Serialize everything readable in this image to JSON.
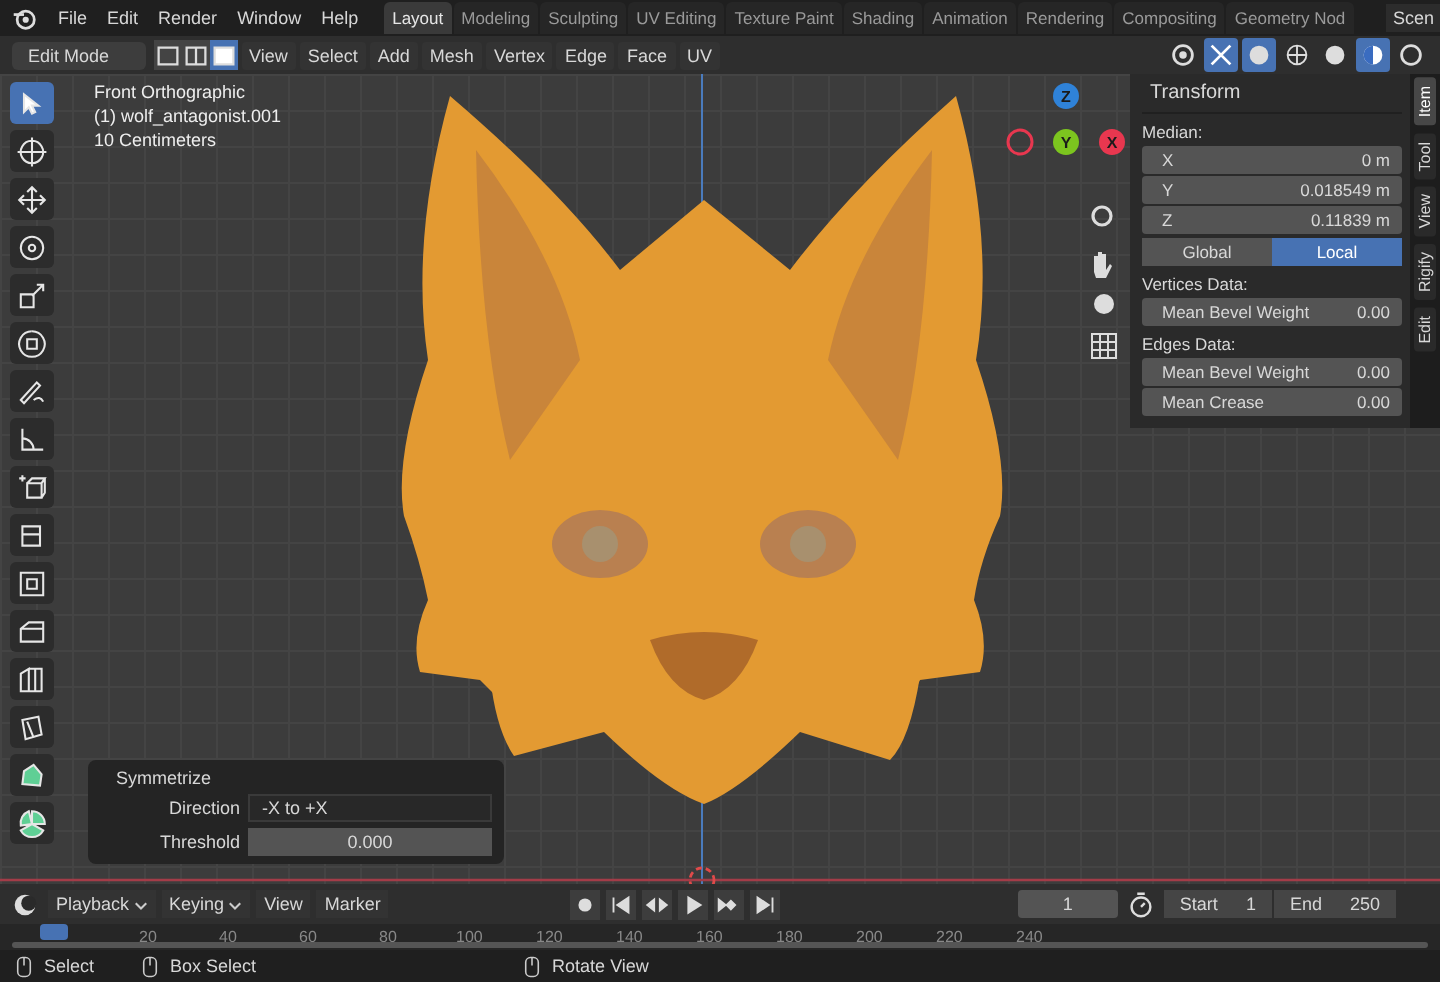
{
  "menu_bar": {
    "menus": [
      "File",
      "Edit",
      "Render",
      "Window",
      "Help"
    ],
    "workspaces": [
      {
        "label": "Layout",
        "selected": true
      },
      {
        "label": "Modeling",
        "selected": false
      },
      {
        "label": "Sculpting",
        "selected": false
      },
      {
        "label": "UV Editing",
        "selected": false
      },
      {
        "label": "Texture Paint",
        "selected": false
      },
      {
        "label": "Shading",
        "selected": false
      },
      {
        "label": "Animation",
        "selected": false
      },
      {
        "label": "Rendering",
        "selected": false
      },
      {
        "label": "Compositing",
        "selected": false
      },
      {
        "label": "Geometry Nod",
        "selected": false
      }
    ],
    "scene": "Scen"
  },
  "header": {
    "mode": "Edit Mode",
    "select_modes": [
      {
        "kind": "vertex",
        "selected": false
      },
      {
        "kind": "edge",
        "selected": false
      },
      {
        "kind": "face",
        "selected": true
      }
    ],
    "menus": [
      "View",
      "Select",
      "Add",
      "Mesh",
      "Vertex",
      "Edge",
      "Face",
      "UV"
    ]
  },
  "viewport": {
    "view_name": "Front Orthographic",
    "object": "(1) wolf_antagonist.001",
    "scale": "10 Centimeters",
    "gizmo_axes": [
      {
        "label": "Z",
        "color": "#2f82d8"
      },
      {
        "label": "Y",
        "color": "#7cc51f"
      },
      {
        "label": "X",
        "color": "#e8374f"
      }
    ]
  },
  "toolbar": {
    "tools": [
      {
        "kind": "select",
        "selected": true
      },
      {
        "kind": "cursor",
        "selected": false
      },
      {
        "kind": "move",
        "selected": false
      },
      {
        "kind": "rotate",
        "selected": false
      },
      {
        "kind": "scale",
        "selected": false
      },
      {
        "kind": "transform",
        "selected": false
      },
      {
        "kind": "annotate",
        "selected": false
      },
      {
        "kind": "measure",
        "selected": false
      },
      {
        "kind": "add-cube",
        "selected": false
      },
      {
        "kind": "extrude",
        "selected": false
      },
      {
        "kind": "inset",
        "selected": false
      },
      {
        "kind": "bevel",
        "selected": false
      },
      {
        "kind": "loop-cut",
        "selected": false
      },
      {
        "kind": "knife",
        "selected": false
      },
      {
        "kind": "poly-build",
        "selected": false
      },
      {
        "kind": "spin",
        "selected": false
      }
    ]
  },
  "sidebar": {
    "tabs": [
      {
        "label": "Item",
        "selected": true
      },
      {
        "label": "Tool",
        "selected": false
      },
      {
        "label": "View",
        "selected": false
      },
      {
        "label": "Rigify",
        "selected": false
      },
      {
        "label": "Edit",
        "selected": false
      }
    ],
    "panel": {
      "title": "Transform",
      "median_label": "Median:",
      "fields": [
        {
          "label": "X",
          "value": "0 m"
        },
        {
          "label": "Y",
          "value": "0.018549 m"
        },
        {
          "label": "Z",
          "value": "0.11839 m"
        }
      ],
      "space_toggle": [
        {
          "label": "Global",
          "selected": false
        },
        {
          "label": "Local",
          "selected": true
        }
      ],
      "sections": [
        {
          "title": "Vertices Data:",
          "fields": [
            {
              "label": "Mean Bevel Weight",
              "value": "0.00"
            }
          ]
        },
        {
          "title": "Edges Data:",
          "fields": [
            {
              "label": "Mean Bevel Weight",
              "value": "0.00"
            },
            {
              "label": "Mean Crease",
              "value": "0.00"
            }
          ]
        }
      ]
    }
  },
  "operator_panel": {
    "title": "Symmetrize",
    "direction_label": "Direction",
    "direction": "-X to +X",
    "threshold_label": "Threshold",
    "threshold": "0.000"
  },
  "timeline": {
    "menus": [
      {
        "label": "Playback",
        "dropdown": true
      },
      {
        "label": "Keying",
        "dropdown": true
      },
      {
        "label": "View",
        "dropdown": false
      },
      {
        "label": "Marker",
        "dropdown": false
      }
    ],
    "current_frame": "1",
    "start_label": "Start",
    "start": "1",
    "end_label": "End",
    "end": "250",
    "ruler": [
      "20",
      "40",
      "60",
      "80",
      "100",
      "120",
      "140",
      "160",
      "180",
      "200",
      "220",
      "240"
    ]
  },
  "status_bar": [
    {
      "label": "Select"
    },
    {
      "label": "Box Select"
    },
    {
      "label": "Rotate View"
    }
  ]
}
